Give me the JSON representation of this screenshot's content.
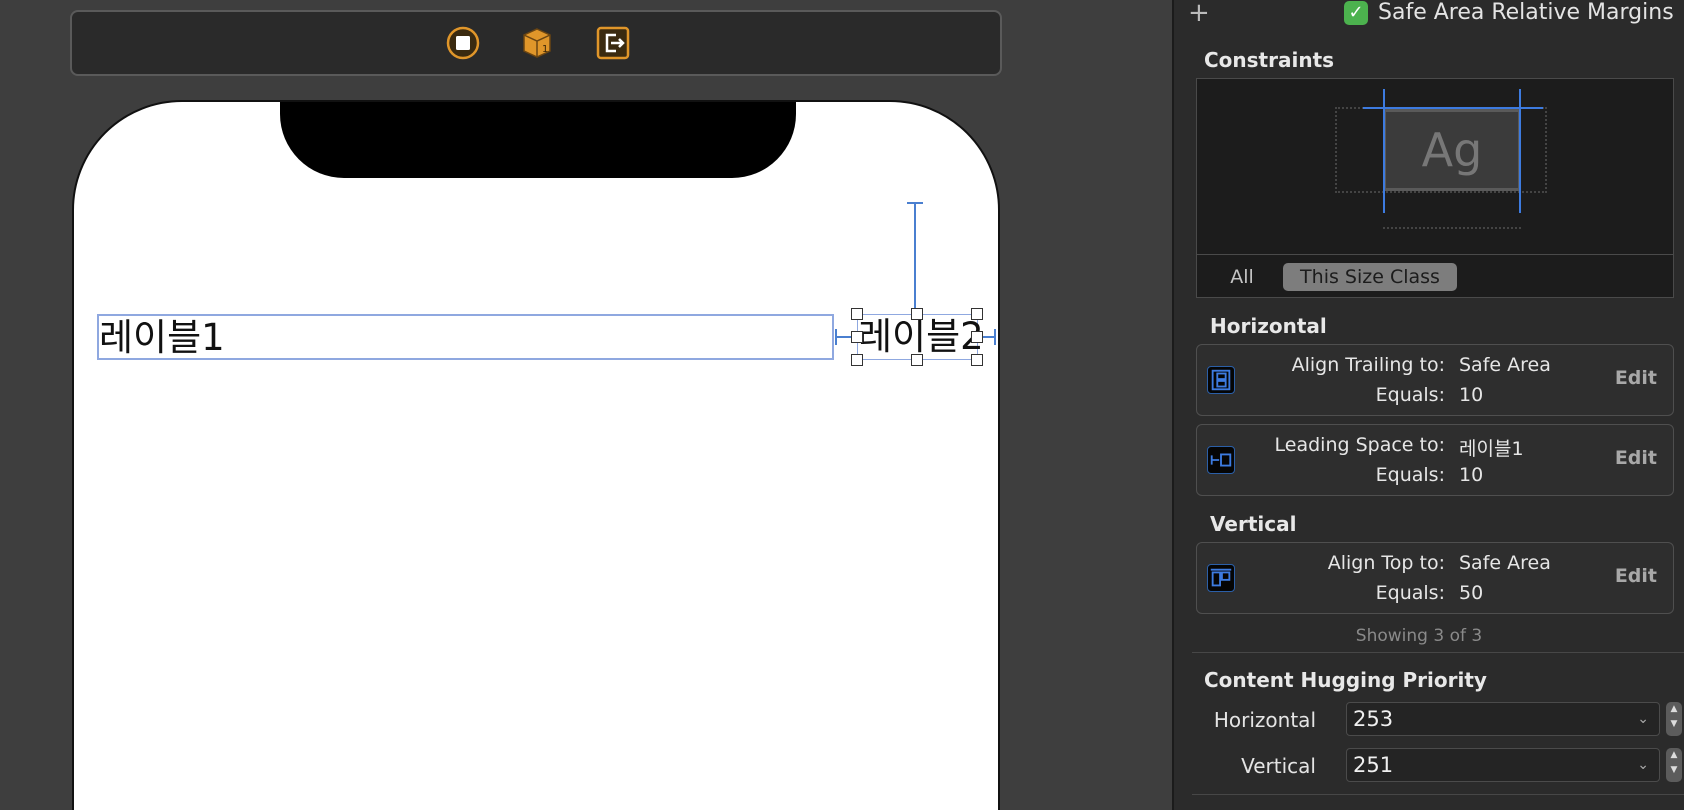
{
  "canvas": {
    "labels": [
      "레이블1",
      "레이블2"
    ]
  },
  "inspector": {
    "plus": "+",
    "safe_area_margins": {
      "label": "Safe Area Relative Margins",
      "checked": true,
      "check_glyph": "✓"
    },
    "constraints": {
      "title": "Constraints",
      "preview_text": "Ag",
      "tabs": [
        {
          "label": "All",
          "selected": false
        },
        {
          "label": "This Size Class",
          "selected": true
        }
      ]
    },
    "horizontal": {
      "title": "Horizontal",
      "items": [
        {
          "icon": "align-trailing-icon",
          "relation_label": "Align Trailing to:",
          "relation_value": "Safe Area",
          "equals_label": "Equals:",
          "equals_value": "10",
          "edit": "Edit"
        },
        {
          "icon": "leading-space-icon",
          "relation_label": "Leading Space to:",
          "relation_value": "레이블1",
          "equals_label": "Equals:",
          "equals_value": "10",
          "edit": "Edit"
        }
      ]
    },
    "vertical": {
      "title": "Vertical",
      "items": [
        {
          "icon": "align-top-icon",
          "relation_label": "Align Top to:",
          "relation_value": "Safe Area",
          "equals_label": "Equals:",
          "equals_value": "50",
          "edit": "Edit"
        }
      ]
    },
    "showing": "Showing 3 of 3",
    "content_hugging": {
      "title": "Content Hugging Priority",
      "horizontal_label": "Horizontal",
      "horizontal_value": "253",
      "vertical_label": "Vertical",
      "vertical_value": "251"
    }
  },
  "colors": {
    "accent_blue": "#3d7be0",
    "check_green": "#4cb24e",
    "icon_orange": "#e0962a"
  }
}
